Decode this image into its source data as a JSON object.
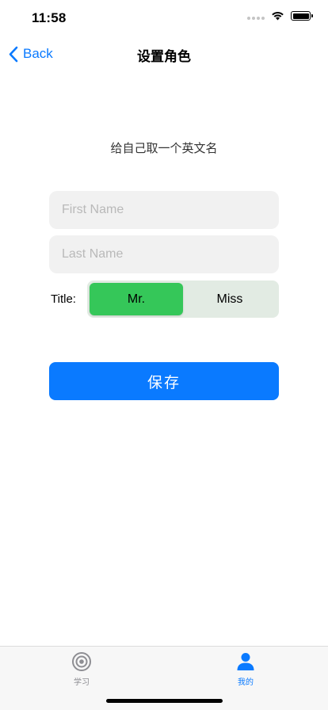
{
  "status_bar": {
    "time": "11:58",
    "icons": [
      "signal-dots-icon",
      "wifi-icon",
      "battery-icon"
    ]
  },
  "nav": {
    "back_label": "Back",
    "title": "设置角色"
  },
  "form": {
    "prompt": "给自己取一个英文名",
    "first_name": {
      "value": "",
      "placeholder": "First Name"
    },
    "last_name": {
      "value": "",
      "placeholder": "Last Name"
    },
    "title_label": "Title:",
    "title_options": [
      "Mr.",
      "Miss"
    ],
    "title_selected": "Mr.",
    "save_label": "保存"
  },
  "tab_bar": {
    "tabs": [
      {
        "label": "学习",
        "icon": "target-icon",
        "active": false
      },
      {
        "label": "我的",
        "icon": "person-icon",
        "active": true
      }
    ]
  },
  "colors": {
    "accent": "#0a7aff",
    "selected_segment": "#35c759",
    "segment_background": "#e2ebe3",
    "field_background": "#f1f1f1"
  }
}
